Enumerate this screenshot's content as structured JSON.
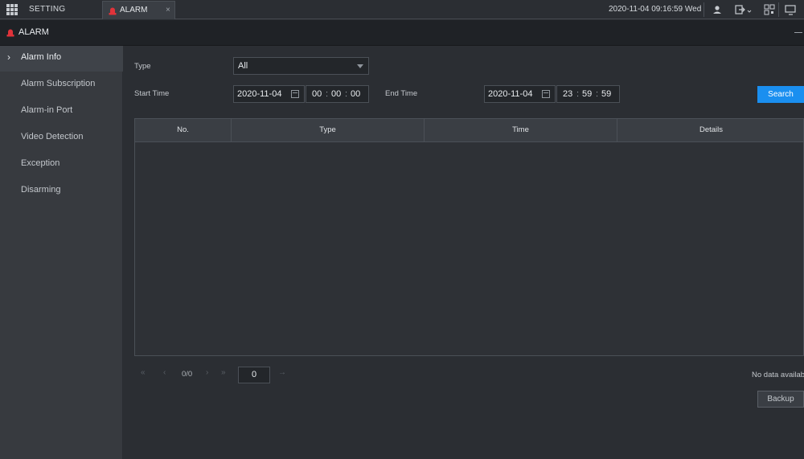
{
  "topbar": {
    "setting_label": "SETTING",
    "tab_alarm_label": "ALARM",
    "tab_close": "×",
    "datetime": "2020-11-04 09:16:59 Wed"
  },
  "titlebar": {
    "title": "ALARM"
  },
  "sidebar": {
    "items": [
      {
        "label": "Alarm Info"
      },
      {
        "label": "Alarm Subscription"
      },
      {
        "label": "Alarm-in Port"
      },
      {
        "label": "Video Detection"
      },
      {
        "label": "Exception"
      },
      {
        "label": "Disarming"
      }
    ]
  },
  "filters": {
    "type_label": "Type",
    "type_value": "All",
    "start_label": "Start Time",
    "start_date": "2020-11-04",
    "start_hh": "00",
    "start_mm": "00",
    "start_ss": "00",
    "end_label": "End Time",
    "end_date": "2020-11-04",
    "end_hh": "23",
    "end_mm": "59",
    "end_ss": "59",
    "time_sep": ":",
    "search_label": "Search"
  },
  "table": {
    "columns": [
      "No.",
      "Type",
      "Time",
      "Details"
    ]
  },
  "pagination": {
    "count": "0/0",
    "page_input": "0",
    "first": "«",
    "prev": "‹",
    "next": "›",
    "last": "»",
    "go": "→"
  },
  "status": {
    "no_data": "No data available"
  },
  "actions": {
    "backup_label": "Backup"
  },
  "colors": {
    "accent": "#1a8ff0",
    "alarm_red": "#e0333a"
  }
}
